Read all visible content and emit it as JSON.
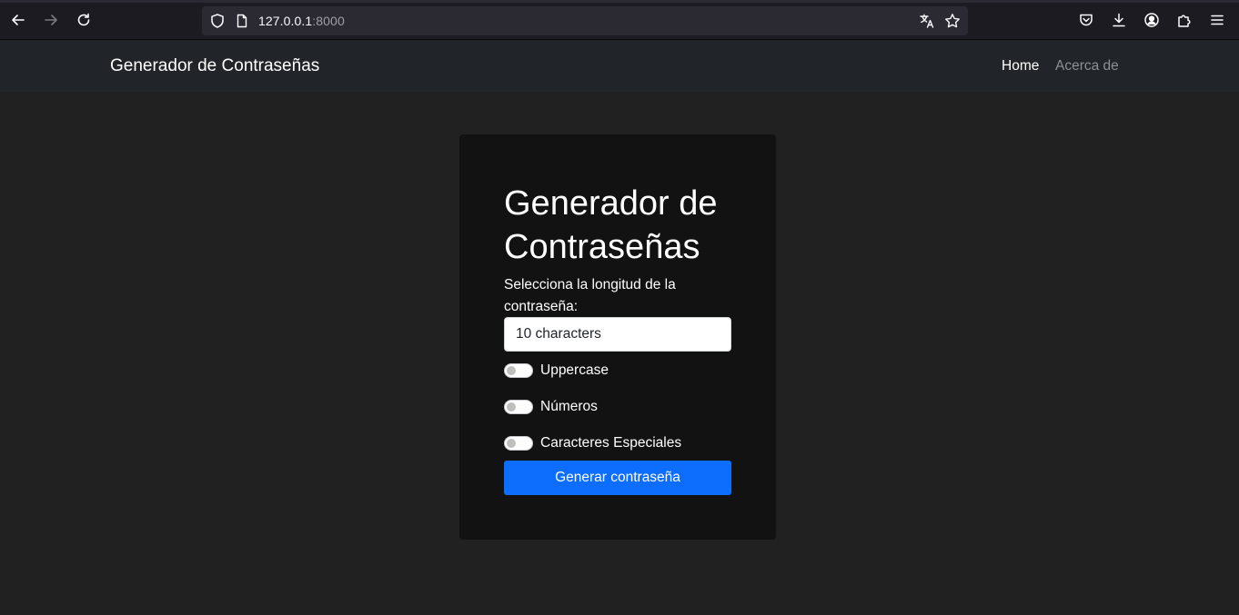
{
  "browser": {
    "url_host": "127.0.0.1",
    "url_port": ":8000"
  },
  "navbar": {
    "brand": "Generador de Contraseñas",
    "links": [
      {
        "label": "Home",
        "active": true
      },
      {
        "label": "Acerca de",
        "active": false
      }
    ]
  },
  "card": {
    "title": "Generador de Contraseñas",
    "length_label": "Selecciona la longitud de la contraseña:",
    "length_selected": "10 characters",
    "options": [
      {
        "label": "Uppercase",
        "checked": false
      },
      {
        "label": "Números",
        "checked": false
      },
      {
        "label": "Caracteres Especiales",
        "checked": false
      }
    ],
    "generate_button": "Generar contraseña"
  },
  "colors": {
    "page_bg": "#212121",
    "navbar_bg": "#212529",
    "card_bg": "#121212",
    "primary": "#0d6efd"
  }
}
